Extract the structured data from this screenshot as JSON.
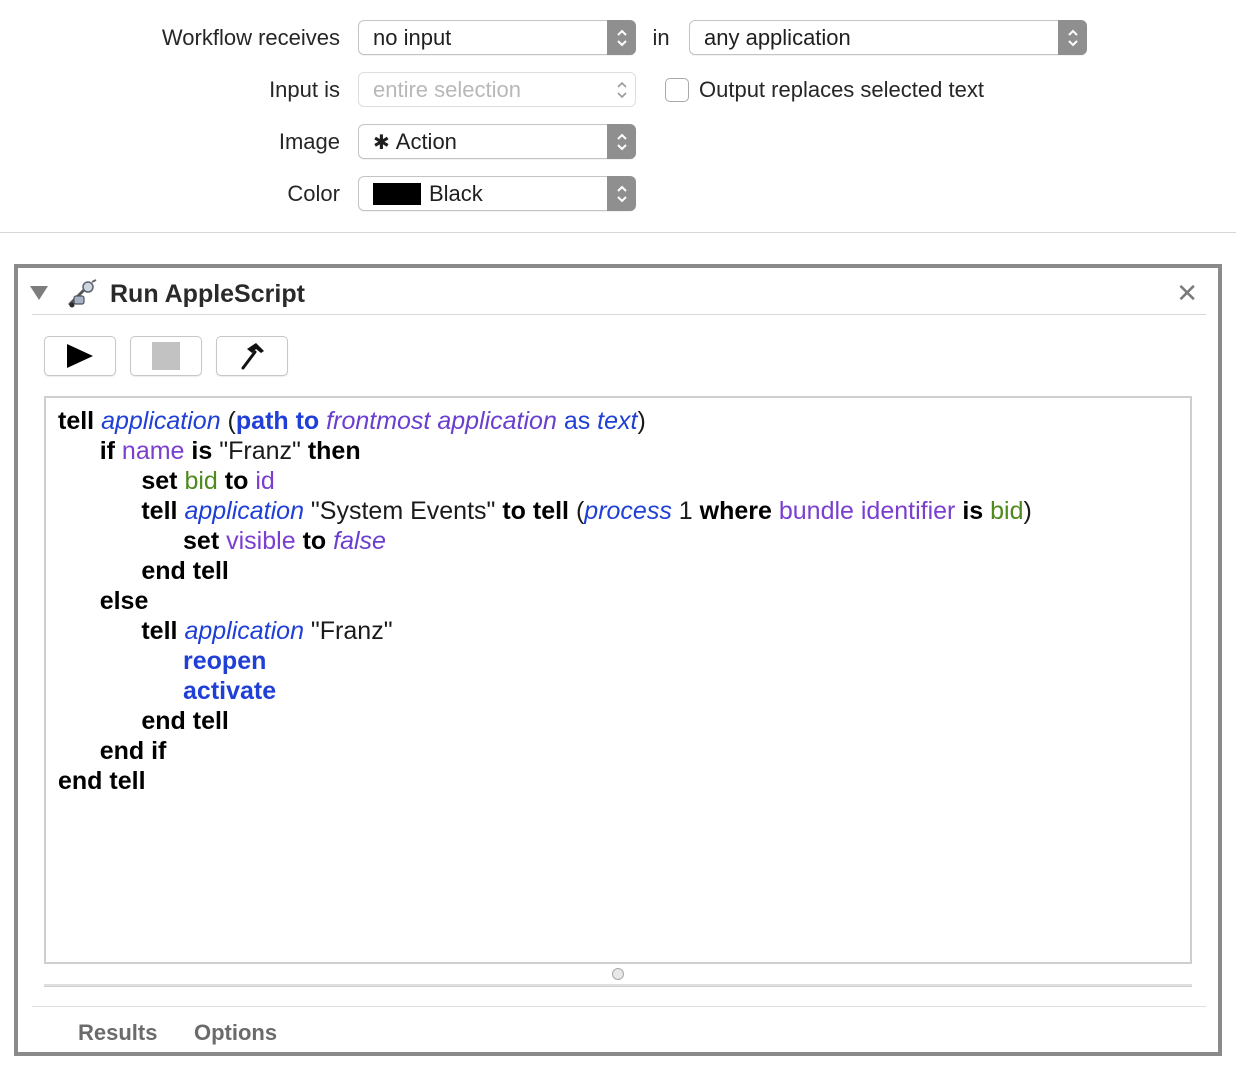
{
  "settings": {
    "workflow_receives_label": "Workflow receives",
    "workflow_receives_value": "no input",
    "in_label": "in",
    "application_value": "any application",
    "input_is_label": "Input is",
    "input_is_value": "entire selection",
    "output_replaces_label": "Output replaces selected text",
    "output_replaces_checked": false,
    "image_label": "Image",
    "image_value": "Action",
    "image_icon": "gear-icon",
    "color_label": "Color",
    "color_value": "Black",
    "color_swatch": "#000000"
  },
  "action": {
    "title": "Run AppleScript",
    "icon": "robot-icon",
    "close_glyph": "✕",
    "toolbar": [
      "run-button",
      "stop-button",
      "compile-button"
    ],
    "code_lines": [
      [
        [
          "tell",
          "k"
        ],
        [
          " ",
          ""
        ],
        [
          "application",
          "ca"
        ],
        [
          " (",
          ""
        ],
        [
          "path to",
          "kb"
        ],
        [
          " ",
          ""
        ],
        [
          "frontmost application",
          "cpi"
        ],
        [
          " ",
          ""
        ],
        [
          "as",
          "cb"
        ],
        [
          " ",
          ""
        ],
        [
          "text",
          "ca"
        ],
        [
          ")",
          ""
        ]
      ],
      [
        [
          "      ",
          ""
        ],
        [
          "if",
          "k"
        ],
        [
          " ",
          ""
        ],
        [
          "name",
          "cp"
        ],
        [
          " ",
          ""
        ],
        [
          "is",
          "k"
        ],
        [
          " \"Franz\" ",
          ""
        ],
        [
          "then",
          "k"
        ]
      ],
      [
        [
          "            ",
          ""
        ],
        [
          "set",
          "k"
        ],
        [
          " ",
          ""
        ],
        [
          "bid",
          "cg"
        ],
        [
          " ",
          ""
        ],
        [
          "to",
          "k"
        ],
        [
          " ",
          ""
        ],
        [
          "id",
          "cp"
        ]
      ],
      [
        [
          "            ",
          ""
        ],
        [
          "tell",
          "k"
        ],
        [
          " ",
          ""
        ],
        [
          "application",
          "ca"
        ],
        [
          " \"System Events\" ",
          ""
        ],
        [
          "to tell",
          "k"
        ],
        [
          " (",
          ""
        ],
        [
          "process",
          "ca"
        ],
        [
          " 1 ",
          ""
        ],
        [
          "where",
          "k"
        ],
        [
          " ",
          ""
        ],
        [
          "bundle identifier",
          "cp"
        ],
        [
          " ",
          ""
        ],
        [
          "is",
          "k"
        ],
        [
          " ",
          ""
        ],
        [
          "bid",
          "cg"
        ],
        [
          ")",
          ""
        ]
      ],
      [
        [
          "                  ",
          ""
        ],
        [
          "set",
          "k"
        ],
        [
          " ",
          ""
        ],
        [
          "visible",
          "cp"
        ],
        [
          " ",
          ""
        ],
        [
          "to",
          "k"
        ],
        [
          " ",
          ""
        ],
        [
          "false",
          "cpi"
        ]
      ],
      [
        [
          "            ",
          ""
        ],
        [
          "end tell",
          "k"
        ]
      ],
      [
        [
          "      ",
          ""
        ],
        [
          "else",
          "k"
        ]
      ],
      [
        [
          "            ",
          ""
        ],
        [
          "tell",
          "k"
        ],
        [
          " ",
          ""
        ],
        [
          "application",
          "ca"
        ],
        [
          " \"Franz\"",
          ""
        ]
      ],
      [
        [
          "                  ",
          ""
        ],
        [
          "reopen",
          "kb"
        ]
      ],
      [
        [
          "                  ",
          ""
        ],
        [
          "activate",
          "kb"
        ]
      ],
      [
        [
          "            ",
          ""
        ],
        [
          "end tell",
          "k"
        ]
      ],
      [
        [
          "      ",
          ""
        ],
        [
          "end if",
          "k"
        ]
      ],
      [
        [
          "end tell",
          "k"
        ]
      ]
    ],
    "tabs": [
      "Results",
      "Options"
    ]
  },
  "colors": {
    "keyword": "#000000",
    "app_keyword": "#1f3fd6",
    "property": "#7a3fd0",
    "variable": "#4e8a1c",
    "panel_border": "#8a8a8a"
  }
}
